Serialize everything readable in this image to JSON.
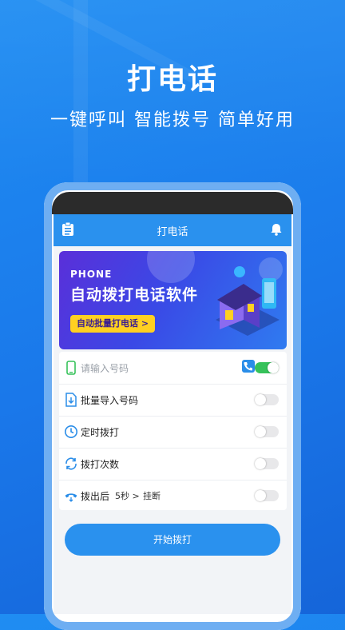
{
  "promo": {
    "headline": "打电话",
    "subline": "一键呼叫 智能拨号 简单好用"
  },
  "app": {
    "title": "打电话",
    "icons": {
      "left": "clipboard-icon",
      "right": "bell-icon"
    }
  },
  "banner": {
    "tag": "PHONE",
    "title": "自动拨打电话软件",
    "button_label": "自动批量打电话 >"
  },
  "settings": {
    "phone_placeholder": "请输入号码",
    "rows": [
      {
        "label": "批量导入号码",
        "icon": "import-icon",
        "enabled": false
      },
      {
        "label": "定时拨打",
        "icon": "clock-icon",
        "enabled": false
      },
      {
        "label": "拨打次数",
        "icon": "redial-icon",
        "enabled": false
      },
      {
        "label": "拨出后",
        "icon": "hangup-icon",
        "enabled": false,
        "delay_text": "5秒 >",
        "action_text": "挂断"
      }
    ],
    "phone_toggle_enabled": true
  },
  "actions": {
    "start_label": "开始拨打"
  },
  "colors": {
    "primary": "#2a91ee",
    "toggle_on": "#36c25a",
    "banner_button": "#ffd021"
  }
}
